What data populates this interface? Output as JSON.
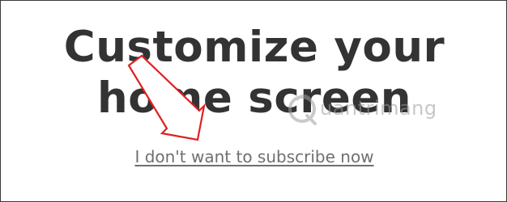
{
  "heading": {
    "text": "Customize your home screen"
  },
  "decline_link": {
    "label": "I don't want to subscribe now"
  },
  "watermark": {
    "text": "uantrimang",
    "icon": "quantrimang-logo-icon"
  },
  "annotation": {
    "icon": "red-arrow-icon",
    "color": "#e02020"
  },
  "colors": {
    "heading": "#333333",
    "link": "#6f6f6f",
    "border": "#3a3a3a"
  }
}
